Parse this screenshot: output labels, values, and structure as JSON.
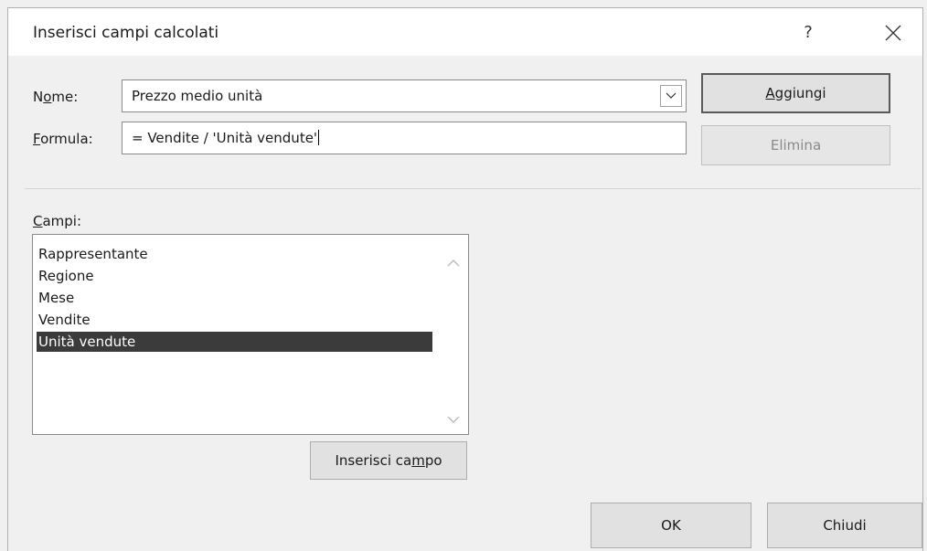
{
  "dialog": {
    "title": "Inserisci campi calcolati",
    "help_label": "?"
  },
  "name_field": {
    "label_accel": "o",
    "label_pre": "N",
    "label_post": "me:",
    "value": "Prezzo medio unità"
  },
  "formula_field": {
    "label_accel": "F",
    "label_post": "ormula:",
    "value": "= Vendite / 'Unità vendute'"
  },
  "buttons": {
    "add_accel": "A",
    "add_rest": "ggiungi",
    "delete": "Elimina",
    "insert_pre": "Inserisci ca",
    "insert_accel": "m",
    "insert_post": "po",
    "ok": "OK",
    "close": "Chiudi"
  },
  "fields": {
    "label_accel": "C",
    "label_post": "ampi:",
    "items": [
      {
        "label": "Rappresentante",
        "selected": false
      },
      {
        "label": "Regione",
        "selected": false
      },
      {
        "label": "Mese",
        "selected": false
      },
      {
        "label": "Vendite",
        "selected": false
      },
      {
        "label": "Unità vendute",
        "selected": true
      }
    ]
  }
}
